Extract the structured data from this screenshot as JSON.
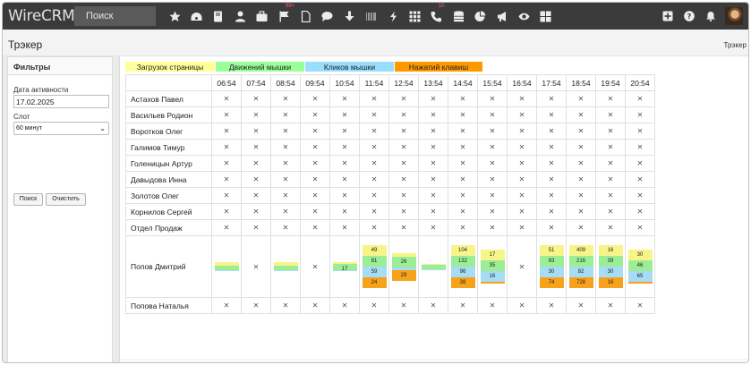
{
  "app": {
    "logo": "WireCRM",
    "search_label": "Поиск",
    "nav_icons": [
      {
        "name": "star-icon"
      },
      {
        "name": "dashboard-icon"
      },
      {
        "name": "book-icon"
      },
      {
        "name": "user-icon"
      },
      {
        "name": "briefcase-icon"
      },
      {
        "name": "flag-icon",
        "badge": "99+"
      },
      {
        "name": "file-icon"
      },
      {
        "name": "chat-icon"
      },
      {
        "name": "download-icon"
      },
      {
        "name": "barcode-icon"
      },
      {
        "name": "bolt-icon"
      },
      {
        "name": "grid-icon"
      },
      {
        "name": "phone-icon",
        "badge": "10"
      },
      {
        "name": "database-icon"
      },
      {
        "name": "pie-chart-icon"
      },
      {
        "name": "megaphone-icon"
      },
      {
        "name": "eye-icon"
      },
      {
        "name": "apps-icon"
      }
    ],
    "right_icons": [
      {
        "name": "plus-square-icon"
      },
      {
        "name": "help-icon"
      },
      {
        "name": "bell-icon"
      }
    ]
  },
  "page": {
    "title": "Трэкер",
    "breadcrumb": "Трэкер"
  },
  "filters": {
    "header": "Фильтры",
    "date_label": "Дата активности",
    "date_value": "17.02.2025",
    "slot_label": "Слот",
    "slot_value": "60 минут",
    "search_button": "Поиск",
    "clear_button": "Очистить"
  },
  "legend": [
    {
      "label": "Загрузок страницы",
      "color": "#ffff99"
    },
    {
      "label": "Движений мышки",
      "color": "#99ff99"
    },
    {
      "label": "Кликов мышки",
      "color": "#99ddff"
    },
    {
      "label": "Нажатий клавиш",
      "color": "#ff9900"
    }
  ],
  "colors": {
    "page_loads": "#f7f58a",
    "mouse_moves": "#9bee94",
    "clicks": "#a6dcf4",
    "keys": "#f7a21b"
  },
  "times": [
    "06:54",
    "07:54",
    "08:54",
    "09:54",
    "10:54",
    "11:54",
    "12:54",
    "13:54",
    "14:54",
    "15:54",
    "16:54",
    "17:54",
    "18:54",
    "19:54",
    "20:54"
  ],
  "empty_mark": "✕",
  "users": [
    {
      "name": "Астахов Павел"
    },
    {
      "name": "Васильев Родион"
    },
    {
      "name": "Воротков Олег"
    },
    {
      "name": "Галимов Тимур"
    },
    {
      "name": "Голеницын Артур"
    },
    {
      "name": "Давыдова Инна"
    },
    {
      "name": "Золотов Олег"
    },
    {
      "name": "Корнилов Сергей"
    },
    {
      "name": "Отдел Продаж"
    },
    {
      "name": "Попов Дмитрий",
      "slots": [
        {
          "p": null,
          "m": null,
          "c": null,
          "k": null,
          "bar": [
            0.3,
            0.4,
            0.1,
            0
          ]
        },
        null,
        {
          "p": null,
          "m": null,
          "c": null,
          "k": null,
          "bar": [
            0.3,
            0.4,
            0.1,
            0
          ]
        },
        null,
        {
          "p": null,
          "m": "17",
          "c": null,
          "k": null,
          "bar": [
            0.2,
            0.6,
            0.1,
            0
          ]
        },
        {
          "p": "49",
          "m": "81",
          "c": "59",
          "k": "24"
        },
        {
          "p": null,
          "m": "26",
          "c": null,
          "k": "29"
        },
        {
          "p": null,
          "m": null,
          "c": null,
          "k": null,
          "bar": [
            0.1,
            0.45,
            0.1,
            0
          ]
        },
        {
          "p": "104",
          "m": "132",
          "c": "96",
          "k": "38"
        },
        {
          "p": "17",
          "m": "35",
          "c": "16",
          "k": null
        },
        null,
        {
          "p": "51",
          "m": "93",
          "c": "30",
          "k": "74"
        },
        {
          "p": "409",
          "m": "216",
          "c": "82",
          "k": "728"
        },
        {
          "p": "16",
          "m": "39",
          "c": "30",
          "k": "16"
        },
        {
          "p": "30",
          "m": "46",
          "c": "65",
          "k": null
        }
      ]
    },
    {
      "name": "Попова Наталья"
    }
  ]
}
